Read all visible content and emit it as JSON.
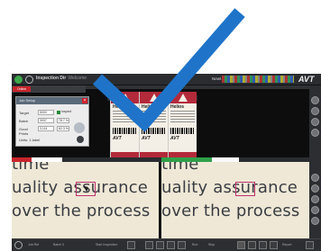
{
  "app": {
    "title": "Inspection Dir",
    "title_sub": "Welcome",
    "user": "Newt",
    "brand": "AVT"
  },
  "upper_tab": {
    "label": "Online"
  },
  "dialog": {
    "title": "Job Setup",
    "rows": [
      {
        "label": "Target",
        "value": "5000",
        "extra": "Inspect"
      },
      {
        "label": "Batch",
        "value": "3937",
        "extra": "78.7 %"
      },
      {
        "label": "Good Prints",
        "value": "3,114",
        "extra": "62.3 %"
      }
    ],
    "footer": "Units: 1 label"
  },
  "labels": {
    "brand": "Helios",
    "logo": "AVT"
  },
  "lower": {
    "tab_left": "Master / Reference",
    "tab_right": "Online",
    "lines": [
      "time",
      "uality assurance",
      "over the process"
    ]
  },
  "status": {
    "items": [
      "Job Ref",
      "Batch 3",
      "Start Inspection",
      "Run",
      "Stop",
      "Report"
    ]
  },
  "colors": {
    "checkmark": "#1f74c9",
    "accent_red": "#c8252c",
    "accent_green": "#2fa04a",
    "label_red": "#b32a3a"
  },
  "icons": [
    "app-logo-icon",
    "checkmark-icon",
    "close-icon",
    "settings-icon",
    "zoom-icon"
  ]
}
